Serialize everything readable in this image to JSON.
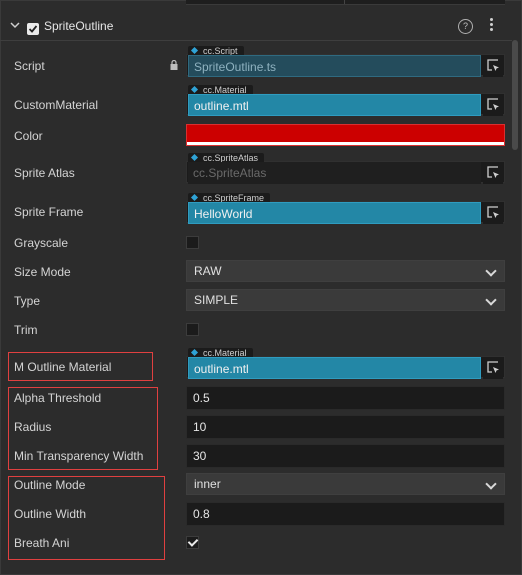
{
  "component": {
    "title": "SpriteOutline",
    "help_glyph": "?",
    "enabled": true
  },
  "icons": {
    "collapse": "chevron-down-icon",
    "enable": "checkbox-checked-icon",
    "help": "help-circle-icon",
    "more": "vertical-dots-icon",
    "lock": "lock-icon",
    "asset_type": "diamond-icon",
    "picker": "locate-picker-icon",
    "select_caret": "chevron-down-icon"
  },
  "colors": {
    "asset_filled": "#2387a6",
    "color_value": "#cc0000",
    "highlight_border": "#e04040"
  },
  "props": {
    "script": {
      "label": "Script",
      "type_tag": "cc.Script",
      "value": "SpriteOutline.ts"
    },
    "custom_material": {
      "label": "CustomMaterial",
      "type_tag": "cc.Material",
      "value": "outline.mtl"
    },
    "color": {
      "label": "Color",
      "value": "#cc0000"
    },
    "sprite_atlas": {
      "label": "Sprite Atlas",
      "type_tag": "cc.SpriteAtlas",
      "value": "cc.SpriteAtlas"
    },
    "sprite_frame": {
      "label": "Sprite Frame",
      "type_tag": "cc.SpriteFrame",
      "value": "HelloWorld"
    },
    "grayscale": {
      "label": "Grayscale",
      "checked": false
    },
    "size_mode": {
      "label": "Size Mode",
      "value": "RAW"
    },
    "type": {
      "label": "Type",
      "value": "SIMPLE"
    },
    "trim": {
      "label": "Trim",
      "checked": false
    },
    "m_outline_material": {
      "label": "M Outline Material",
      "type_tag": "cc.Material",
      "value": "outline.mtl"
    },
    "alpha_threshold": {
      "label": "Alpha Threshold",
      "value": "0.5"
    },
    "radius": {
      "label": "Radius",
      "value": "10"
    },
    "min_transparency_width": {
      "label": "Min Transparency Width",
      "value": "30"
    },
    "outline_mode": {
      "label": "Outline Mode",
      "value": "inner"
    },
    "outline_width": {
      "label": "Outline Width",
      "value": "0.8"
    },
    "breath_ani": {
      "label": "Breath Ani",
      "checked": true
    }
  }
}
